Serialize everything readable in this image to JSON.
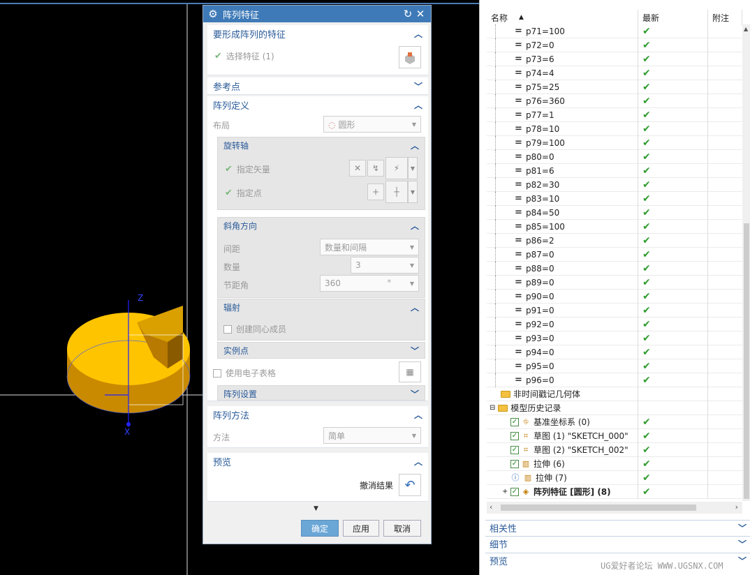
{
  "viewport": {
    "axis_z": "Z",
    "axis_x": "X",
    "part_color": "#f5c000"
  },
  "dialog": {
    "title": "阵列特征",
    "groups": {
      "feature": {
        "title": "要形成阵列的特征",
        "select_label": "选择特征 (1)"
      },
      "refpoint": {
        "title": "参考点"
      },
      "definition": {
        "title": "阵列定义",
        "layout_label": "布局",
        "layout_value": "圆形",
        "rotation_axis": {
          "title": "旋转轴",
          "vector_label": "指定矢量",
          "point_label": "指定点"
        },
        "angle_direction": {
          "title": "斜角方向",
          "spacing_label": "间距",
          "spacing_value": "数量和间隔",
          "count_label": "数量",
          "count_value": "3",
          "pitch_label": "节距角",
          "pitch_value": "360",
          "pitch_unit": "°"
        },
        "radiation": {
          "title": "辐射",
          "concentric_label": "创建同心成员"
        },
        "instance_point": {
          "title": "实例点",
          "spreadsheet_label": "使用电子表格"
        },
        "pattern_settings": {
          "title": "阵列设置"
        }
      },
      "method": {
        "title": "阵列方法",
        "method_label": "方法",
        "method_value": "简单"
      },
      "preview": {
        "title": "预览",
        "undo_label": "撤消结果"
      }
    },
    "buttons": {
      "ok": "确定",
      "apply": "应用",
      "cancel": "取消"
    }
  },
  "navigator": {
    "columns": [
      "名称",
      "最新",
      "附注"
    ],
    "expressions": [
      "p71=100",
      "p72=0",
      "p73=6",
      "p74=4",
      "p75=25",
      "p76=360",
      "p77=1",
      "p78=10",
      "p79=100",
      "p80=0",
      "p81=6",
      "p82=30",
      "p83=10",
      "p84=50",
      "p85=100",
      "p86=2",
      "p87=0",
      "p88=0",
      "p89=0",
      "p90=0",
      "p91=0",
      "p92=0",
      "p93=0",
      "p94=0",
      "p95=0",
      "p96=0"
    ],
    "folders": {
      "non_timestamp": "非时间戳记几何体",
      "history": "模型历史记录"
    },
    "history": [
      {
        "label": "基准坐标系 (0)",
        "icon": "datum-csys-icon"
      },
      {
        "label": "草图 (1) \"SKETCH_000\"",
        "icon": "sketch-icon"
      },
      {
        "label": "草图 (2) \"SKETCH_002\"",
        "icon": "sketch-icon"
      },
      {
        "label": "拉伸 (6)",
        "icon": "extrude-icon"
      },
      {
        "label": "拉伸 (7)",
        "icon": "extrude-icon"
      },
      {
        "label": "阵列特征 [圆形] (8)",
        "icon": "pattern-icon"
      }
    ],
    "panels": [
      "相关性",
      "细节",
      "预览"
    ]
  },
  "watermark": "UG爱好者论坛 WWW.UGSNX.COM"
}
